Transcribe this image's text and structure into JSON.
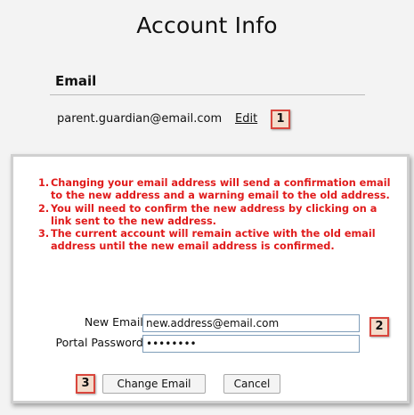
{
  "page": {
    "title": "Account Info"
  },
  "email_section": {
    "heading": "Email",
    "current_email": "parent.guardian@email.com",
    "edit_label": "Edit"
  },
  "callouts": {
    "one": "1",
    "two": "2",
    "three": "3"
  },
  "change_panel": {
    "notes": [
      {
        "num": "1.",
        "text": "Changing your email address will send a confirmation email to the new address and a warning email to the old address."
      },
      {
        "num": "2.",
        "text": "You will need to confirm the new address by clicking on a link sent to the new address."
      },
      {
        "num": "3.",
        "text": "The current account will remain active with the old email address until the new email address is confirmed."
      }
    ],
    "new_email_label": "New Email:",
    "new_email_value": "new.address@email.com",
    "password_label": "Portal Password:",
    "password_value": "••••••••",
    "change_button": "Change Email",
    "cancel_button": "Cancel"
  },
  "colors": {
    "note_text": "#e01b1b",
    "callout_border": "#d9453c",
    "callout_fill": "#f4dccb",
    "page_background": "#f3f3f3"
  }
}
